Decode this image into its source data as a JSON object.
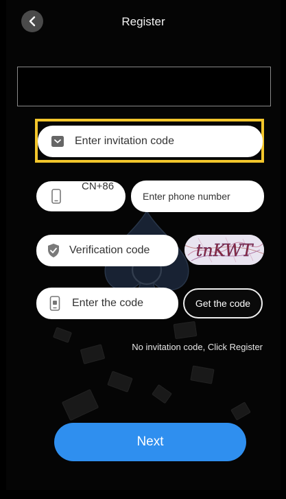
{
  "header": {
    "title": "Register",
    "back_icon": "chevron-left-icon"
  },
  "invitation": {
    "placeholder": "Enter invitation code",
    "icon": "envelope-icon"
  },
  "phone": {
    "country_code": "CN+86",
    "placeholder": "Enter phone number",
    "icon": "phone-icon"
  },
  "verification": {
    "placeholder": "Verification code",
    "icon": "shield-icon",
    "captcha_text": "tnKWT"
  },
  "sms": {
    "placeholder": "Enter the code",
    "icon": "sms-phone-icon",
    "get_code_label": "Get the code"
  },
  "hint": "No invitation code, Click Register",
  "next_label": "Next",
  "colors": {
    "highlight": "#f3c62b",
    "primary_button": "#2f8fef",
    "background": "#050505"
  }
}
